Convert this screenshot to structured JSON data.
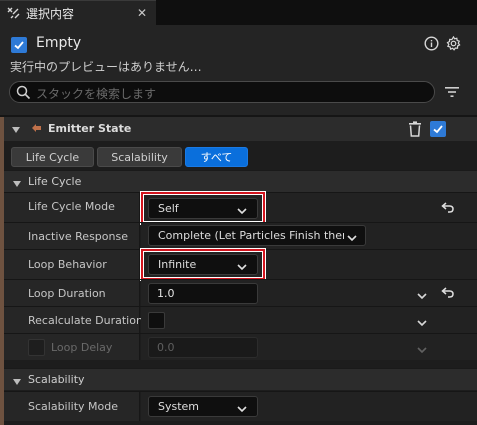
{
  "tab": {
    "title": "選択内容",
    "close": "✕"
  },
  "header": {
    "title": "Empty",
    "subtitle": "実行中のプレビューはありません…",
    "search_placeholder": "スタックを検索します"
  },
  "emitter": {
    "title": "Emitter State"
  },
  "filter_tabs": [
    {
      "label": "Life Cycle",
      "active": false
    },
    {
      "label": "Scalability",
      "active": false
    },
    {
      "label": "すべて",
      "active": true
    }
  ],
  "sections": {
    "life_cycle": "Life Cycle",
    "scalability": "Scalability"
  },
  "properties": {
    "life_cycle_mode": {
      "label": "Life Cycle Mode",
      "value": "Self"
    },
    "inactive_response": {
      "label": "Inactive Response",
      "value": "Complete (Let Particles Finish then"
    },
    "loop_behavior": {
      "label": "Loop Behavior",
      "value": "Infinite"
    },
    "loop_duration": {
      "label": "Loop Duration",
      "value": "1.0"
    },
    "recalculate_duration": {
      "label": "Recalculate Duration"
    },
    "loop_delay": {
      "label": "Loop Delay",
      "value": "0.0"
    },
    "scalability_mode": {
      "label": "Scalability Mode",
      "value": "System"
    }
  },
  "colors": {
    "accent": "#0a6fdc",
    "highlight": "#d4141e",
    "emitter_bar": "#6e5240"
  },
  "icons": [
    "details-panel-icon",
    "close-icon",
    "checkbox-icon",
    "info-icon",
    "gear-icon",
    "search-icon",
    "filter-icon",
    "chevron-down-icon",
    "emitter-icon",
    "trash-icon",
    "reset-arrow-icon"
  ]
}
